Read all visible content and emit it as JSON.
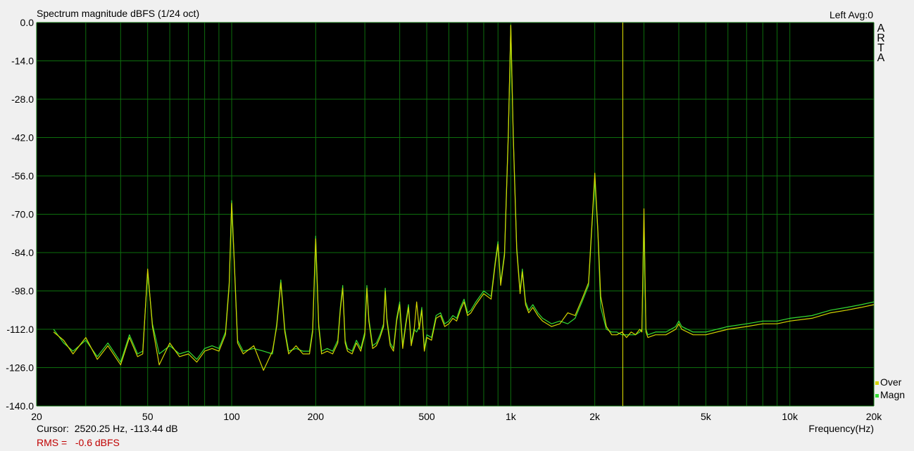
{
  "header": {
    "title": "Spectrum magnitude dBFS (1/24 oct)",
    "channel_info": "Left  Avg:0"
  },
  "brand": {
    "letters": [
      "A",
      "R",
      "T",
      "A"
    ]
  },
  "status": {
    "cursor_label": "Cursor:",
    "cursor_value": "2520.25 Hz, -113.44 dB",
    "rms_label": "RMS =",
    "rms_value": "-0.6 dBFS"
  },
  "legend": {
    "items": [
      {
        "label": "Over",
        "color": "#d4d400"
      },
      {
        "label": "Magn",
        "color": "#33dd33"
      }
    ]
  },
  "colors": {
    "plot_bg": "#000000",
    "grid": "#0d6e0d",
    "magn": "#33dd33",
    "over": "#d4d400",
    "cursor": "#e8e800"
  },
  "chart_data": {
    "type": "line",
    "title": "Spectrum magnitude dBFS (1/24 oct)",
    "xlabel": "Frequency(Hz)",
    "ylabel": "",
    "x_scale": "log",
    "xlim": [
      20,
      20000
    ],
    "ylim": [
      -140,
      0
    ],
    "x_ticks": [
      20,
      50,
      100,
      200,
      500,
      1000,
      2000,
      5000,
      10000,
      20000
    ],
    "x_tick_labels": [
      "20",
      "50",
      "100",
      "200",
      "500",
      "1k",
      "2k",
      "5k",
      "10k",
      "20k"
    ],
    "y_ticks": [
      0,
      -14,
      -28,
      -42,
      -56,
      -70,
      -84,
      -98,
      -112,
      -126,
      -140
    ],
    "y_tick_labels": [
      "0.0",
      "-14.0",
      "-28.0",
      "-42.0",
      "-56.0",
      "-70.0",
      "-84.0",
      "-98.0",
      "-112.0",
      "-126.0",
      "-140.0"
    ],
    "cursor_x": 2520.25,
    "grid": true,
    "legend_position": "bottom-right",
    "series": [
      {
        "name": "Magn",
        "x": [
          23,
          25,
          27,
          30,
          33,
          36,
          40,
          43,
          46,
          48,
          50,
          52,
          55,
          60,
          65,
          70,
          75,
          80,
          85,
          90,
          95,
          98,
          100,
          102,
          105,
          110,
          120,
          130,
          140,
          145,
          150,
          155,
          160,
          170,
          180,
          190,
          195,
          200,
          205,
          210,
          220,
          230,
          240,
          245,
          250,
          255,
          260,
          270,
          280,
          290,
          300,
          305,
          310,
          320,
          330,
          340,
          350,
          355,
          360,
          370,
          380,
          390,
          400,
          410,
          420,
          430,
          440,
          450,
          460,
          470,
          480,
          490,
          500,
          520,
          540,
          560,
          580,
          600,
          620,
          640,
          660,
          680,
          700,
          720,
          750,
          800,
          850,
          880,
          900,
          920,
          950,
          980,
          1000,
          1020,
          1050,
          1080,
          1100,
          1130,
          1160,
          1200,
          1250,
          1300,
          1400,
          1500,
          1600,
          1700,
          1800,
          1900,
          1950,
          2000,
          2050,
          2100,
          2200,
          2300,
          2400,
          2500,
          2600,
          2700,
          2800,
          2900,
          2950,
          3000,
          3050,
          3100,
          3300,
          3600,
          3900,
          4000,
          4100,
          4500,
          5000,
          6000,
          7000,
          8000,
          9000,
          10000,
          12000,
          14000,
          16000,
          18000,
          20000
        ],
        "y": [
          -112,
          -117,
          -120,
          -116,
          -122,
          -117,
          -124,
          -114,
          -121,
          -120,
          -91,
          -110,
          -121,
          -118,
          -121,
          -120,
          -123,
          -119,
          -118,
          -119,
          -113,
          -95,
          -65,
          -85,
          -116,
          -120,
          -119,
          -120,
          -121,
          -110,
          -94,
          -112,
          -120,
          -119,
          -120,
          -120,
          -112,
          -78,
          -110,
          -120,
          -119,
          -120,
          -116,
          -104,
          -96,
          -116,
          -119,
          -120,
          -116,
          -119,
          -113,
          -96,
          -108,
          -118,
          -117,
          -114,
          -110,
          -97,
          -108,
          -117,
          -119,
          -108,
          -102,
          -118,
          -110,
          -103,
          -117,
          -112,
          -113,
          -111,
          -104,
          -119,
          -114,
          -115,
          -107,
          -106,
          -110,
          -109,
          -107,
          -108,
          -104,
          -101,
          -106,
          -105,
          -102,
          -98,
          -100,
          -87,
          -80,
          -95,
          -84,
          -40,
          -1,
          -40,
          -82,
          -98,
          -90,
          -102,
          -105,
          -103,
          -106,
          -108,
          -110,
          -109,
          -110,
          -108,
          -102,
          -96,
          -76,
          -57,
          -76,
          -104,
          -112,
          -113,
          -113,
          -114,
          -114,
          -114,
          -114,
          -113,
          -112,
          -72,
          -112,
          -114,
          -113,
          -113,
          -111,
          -109,
          -111,
          -113,
          -113,
          -111,
          -110,
          -109,
          -109,
          -108,
          -107,
          -105,
          -104,
          -103,
          -102
        ]
      },
      {
        "name": "Over",
        "x": [
          23,
          25,
          27,
          30,
          33,
          36,
          40,
          43,
          46,
          48,
          50,
          52,
          55,
          60,
          65,
          70,
          75,
          80,
          85,
          90,
          95,
          98,
          100,
          102,
          105,
          110,
          120,
          130,
          140,
          145,
          150,
          155,
          160,
          170,
          180,
          190,
          195,
          200,
          205,
          210,
          220,
          230,
          240,
          245,
          250,
          255,
          260,
          270,
          280,
          290,
          300,
          305,
          310,
          320,
          330,
          340,
          350,
          355,
          360,
          370,
          380,
          390,
          400,
          410,
          420,
          430,
          440,
          450,
          460,
          470,
          480,
          490,
          500,
          520,
          540,
          560,
          580,
          600,
          620,
          640,
          660,
          680,
          700,
          720,
          750,
          800,
          850,
          880,
          900,
          920,
          950,
          980,
          1000,
          1020,
          1050,
          1080,
          1100,
          1130,
          1160,
          1200,
          1250,
          1300,
          1400,
          1500,
          1600,
          1700,
          1800,
          1900,
          1950,
          2000,
          2050,
          2100,
          2200,
          2300,
          2400,
          2500,
          2600,
          2700,
          2800,
          2900,
          2950,
          3000,
          3050,
          3100,
          3300,
          3600,
          3900,
          4000,
          4100,
          4500,
          5000,
          6000,
          7000,
          8000,
          9000,
          10000,
          12000,
          14000,
          16000,
          18000,
          20000
        ],
        "y": [
          -113,
          -116,
          -121,
          -115,
          -123,
          -118,
          -125,
          -115,
          -122,
          -121,
          -90,
          -111,
          -125,
          -117,
          -122,
          -121,
          -124,
          -120,
          -119,
          -120,
          -114,
          -96,
          -66,
          -86,
          -117,
          -121,
          -118,
          -127,
          -120,
          -111,
          -95,
          -113,
          -121,
          -118,
          -121,
          -121,
          -113,
          -79,
          -111,
          -121,
          -120,
          -121,
          -117,
          -105,
          -97,
          -117,
          -120,
          -121,
          -117,
          -120,
          -114,
          -97,
          -109,
          -119,
          -118,
          -115,
          -111,
          -98,
          -109,
          -118,
          -120,
          -109,
          -103,
          -119,
          -111,
          -104,
          -118,
          -113,
          -102,
          -112,
          -105,
          -120,
          -115,
          -116,
          -108,
          -107,
          -111,
          -110,
          -108,
          -109,
          -105,
          -102,
          -107,
          -106,
          -103,
          -99,
          -101,
          -88,
          -81,
          -96,
          -85,
          -41,
          -1,
          -41,
          -83,
          -99,
          -91,
          -103,
          -106,
          -104,
          -107,
          -109,
          -111,
          -110,
          -106,
          -107,
          -101,
          -95,
          -75,
          -55,
          -75,
          -100,
          -111,
          -114,
          -114,
          -113,
          -115,
          -113,
          -114,
          -112,
          -113,
          -68,
          -113,
          -115,
          -114,
          -114,
          -112,
          -110,
          -112,
          -114,
          -114,
          -112,
          -111,
          -110,
          -110,
          -109,
          -108,
          -106,
          -105,
          -104,
          -103
        ]
      }
    ]
  }
}
